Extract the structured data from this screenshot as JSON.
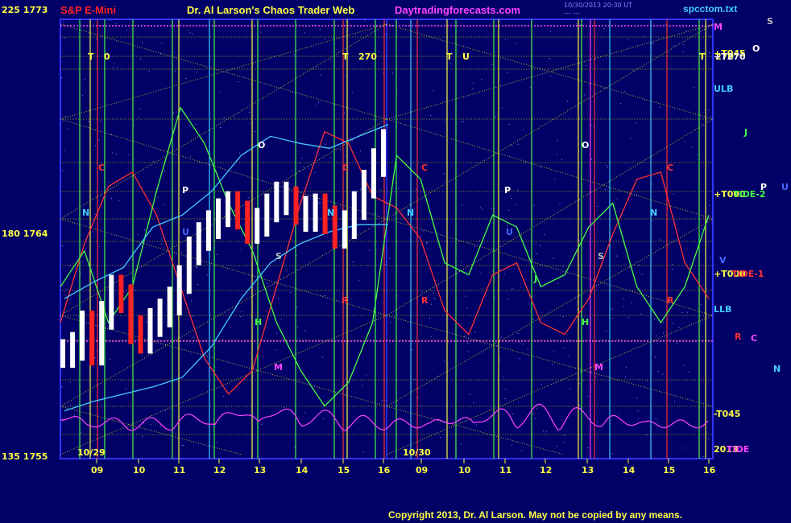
{
  "header": {
    "symbol": "S&P E-Mini",
    "title": "Dr. Al Larson's Chaos Trader Web",
    "site": "Daytradingforecasts.com",
    "timestamp_line1": "10/30/2013 20:30 UT",
    "timestamp_line2": "--- ---",
    "file": "spcctom.txt"
  },
  "footer": {
    "copyright": "Copyright 2013, Dr. Al Larson. May not be copied by any means."
  },
  "left_axis": [
    {
      "label": "225 1773"
    },
    {
      "label": "180 1764"
    },
    {
      "label": "135 1755"
    }
  ],
  "x_hours": [
    "09",
    "10",
    "11",
    "12",
    "13",
    "14",
    "15",
    "16",
    "09",
    "10",
    "11",
    "12",
    "13",
    "14",
    "15",
    "16"
  ],
  "dates": [
    "10/29",
    "10/30"
  ],
  "right_labels": [
    {
      "text": "M",
      "color": "#ff44ff"
    },
    {
      "text": "+T045",
      "color": "#ffff44"
    },
    {
      "text": "+T270",
      "color": "#ffffff"
    },
    {
      "text": "ULB",
      "color": "#44ccff"
    },
    {
      "text": "+T000",
      "color": "#ffff44"
    },
    {
      "text": "TIDE-2",
      "color": "#44ff44"
    },
    {
      "text": "V",
      "color": "#4466ff"
    },
    {
      "text": "+T000",
      "color": "#ffff44"
    },
    {
      "text": "TIDE-1",
      "color": "#ff3333"
    },
    {
      "text": "LLB",
      "color": "#44ccff"
    },
    {
      "text": "-T045",
      "color": "#ffff44"
    },
    {
      "text": "2013",
      "color": "#ffff44"
    },
    {
      "text": "TIDE",
      "color": "#ff44ff"
    }
  ],
  "far_right_labels": [
    {
      "text": "S",
      "color": "#bbbbbb"
    },
    {
      "text": "O",
      "color": "#ffffff"
    },
    {
      "text": "J",
      "color": "#44ff44"
    },
    {
      "text": "P",
      "color": "#ffffff"
    },
    {
      "text": "U",
      "color": "#4466ff"
    },
    {
      "text": "R",
      "color": "#ff3333"
    },
    {
      "text": "C",
      "color": "#ff44ff"
    },
    {
      "text": "N",
      "color": "#44ccff"
    }
  ],
  "planet_marks": [
    {
      "text": "T",
      "color": "#ffff44"
    },
    {
      "text": "0",
      "color": "#ffff44"
    },
    {
      "text": "T",
      "color": "#ffff44"
    },
    {
      "text": "270",
      "color": "#ffff44"
    },
    {
      "text": "T",
      "color": "#ffff44"
    },
    {
      "text": "U",
      "color": "#ffff44"
    },
    {
      "text": "T",
      "color": "#ffff44"
    },
    {
      "text": "270",
      "color": "#ffff44"
    },
    {
      "text": "C",
      "color": "#ff3333"
    },
    {
      "text": "C",
      "color": "#ff3333"
    },
    {
      "text": "C",
      "color": "#ff3333"
    },
    {
      "text": "C",
      "color": "#ff3333"
    },
    {
      "text": "O",
      "color": "#ffffff"
    },
    {
      "text": "O",
      "color": "#ffffff"
    },
    {
      "text": "P",
      "color": "#ffffff"
    },
    {
      "text": "P",
      "color": "#ffffff"
    },
    {
      "text": "N",
      "color": "#44ccff"
    },
    {
      "text": "N",
      "color": "#44ccff"
    },
    {
      "text": "N",
      "color": "#44ccff"
    },
    {
      "text": "N",
      "color": "#44ccff"
    },
    {
      "text": "U",
      "color": "#4466ff"
    },
    {
      "text": "U",
      "color": "#4466ff"
    },
    {
      "text": "S",
      "color": "#bbbbbb"
    },
    {
      "text": "S",
      "color": "#bbbbbb"
    },
    {
      "text": "J",
      "color": "#44ff44"
    },
    {
      "text": "R",
      "color": "#ff3333"
    },
    {
      "text": "R",
      "color": "#ff3333"
    },
    {
      "text": "R",
      "color": "#ff3333"
    },
    {
      "text": "H",
      "color": "#44ff44"
    },
    {
      "text": "H",
      "color": "#44ff44"
    },
    {
      "text": "M",
      "color": "#ff44ff"
    },
    {
      "text": "M",
      "color": "#ff44ff"
    }
  ],
  "chart_data": {
    "type": "line",
    "title": "S&P E-Mini",
    "ylim": [
      1755,
      1773
    ],
    "y_ticks": [
      1755,
      1764,
      1773
    ],
    "angle_ticks": [
      135,
      180,
      225
    ],
    "x_categories": [
      "09",
      "10",
      "11",
      "12",
      "13",
      "14",
      "15",
      "16",
      "09",
      "10",
      "11",
      "12",
      "13",
      "14",
      "15",
      "16"
    ],
    "series": [
      {
        "name": "price",
        "color": "#ffffff",
        "values": [
          1759.2,
          1759.5,
          1760.4,
          1759.3,
          1760.8,
          1761.9,
          1761.5,
          1760.2,
          1759.8,
          1760.5,
          1760.9,
          1761.4,
          1762.3,
          1763.5,
          1764.1,
          1764.6,
          1765.1,
          1765.4,
          1765.0,
          1764.4,
          1764.7,
          1765.3,
          1765.8,
          1765.6,
          1765.2,
          1764.9,
          1765.3,
          1764.8,
          1764.2,
          1764.6,
          1765.4,
          1766.3,
          1767.2,
          1768.0
        ]
      },
      {
        "name": "TIDE-1",
        "color": "#ff3333",
        "values": [
          1760.5,
          1763.8,
          1766.2,
          1766.8,
          1765.0,
          1762.0,
          1759.0,
          1757.5,
          1758.5,
          1762.0,
          1765.5,
          1768.5,
          1768.0,
          1765.8,
          1765.3,
          1764.0,
          1761.0,
          1760.0,
          1762.5,
          1763.0,
          1760.5,
          1760.0,
          1761.5,
          1764.2,
          1766.5,
          1766.8,
          1763.0,
          1761.5
        ]
      },
      {
        "name": "TIDE-2",
        "color": "#44ff44",
        "values": [
          1762.0,
          1763.5,
          1760.5,
          1762.0,
          1766.0,
          1769.5,
          1768.0,
          1765.5,
          1763.5,
          1760.5,
          1758.5,
          1757.0,
          1758.0,
          1760.5,
          1767.5,
          1766.5,
          1763.0,
          1762.5,
          1765.0,
          1764.5,
          1762.0,
          1762.5,
          1764.5,
          1765.5,
          1762.0,
          1760.5,
          1762.0,
          1765.0
        ]
      },
      {
        "name": "ULB",
        "color": "#44ccff",
        "values": [
          1761.5,
          1762.2,
          1762.8,
          1764.5,
          1765.0,
          1766.0,
          1767.5,
          1768.3,
          1768.0,
          1767.8,
          1768.3,
          1768.8
        ]
      },
      {
        "name": "LLB",
        "color": "#44ccff",
        "values": [
          1756.8,
          1757.2,
          1757.5,
          1757.8,
          1758.2,
          1759.5,
          1761.5,
          1763.0,
          1763.8,
          1764.3,
          1764.6,
          1764.6
        ]
      }
    ]
  }
}
